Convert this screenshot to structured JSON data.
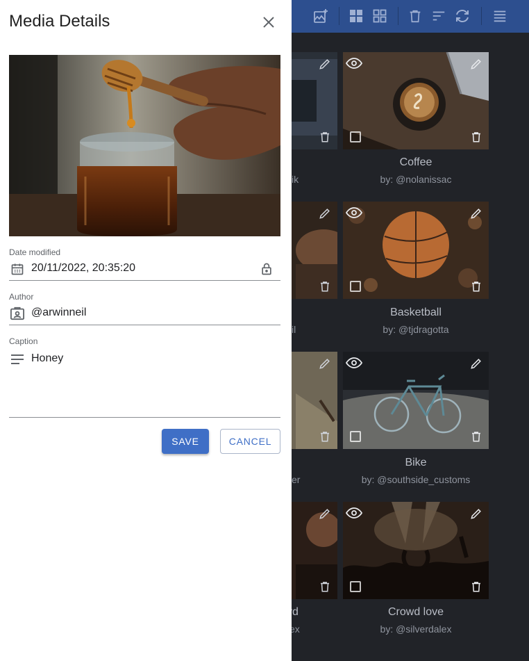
{
  "panel": {
    "title": "Media Details",
    "fields": {
      "date": {
        "label": "Date modified",
        "value": "20/11/2022, 20:35:20"
      },
      "author": {
        "label": "Author",
        "value": "@arwinneil"
      },
      "caption": {
        "label": "Caption",
        "value": "Honey"
      }
    },
    "buttons": {
      "save": "SAVE",
      "cancel": "CANCEL"
    }
  },
  "toolbar": {
    "icons": [
      "add-photo-icon",
      "grid-large-icon",
      "grid-small-icon",
      "delete-icon",
      "sort-icon",
      "refresh-icon",
      "list-view-icon"
    ]
  },
  "gallery": {
    "left_column_partial": [
      {
        "title": "",
        "author": "ik"
      },
      {
        "title": "",
        "author": "il"
      },
      {
        "title": "",
        "author": "er"
      },
      {
        "title": "vd",
        "author": "ex"
      }
    ],
    "right_column": [
      {
        "title": "Coffee",
        "author": "by: @nolanissac"
      },
      {
        "title": "Basketball",
        "author": "by: @tjdragotta"
      },
      {
        "title": "Bike",
        "author": "by: @southside_customs"
      },
      {
        "title": "Crowd love",
        "author": "by: @silverdalex"
      }
    ]
  },
  "colors": {
    "toolbar": "#2d4f8f",
    "accent": "#3f6fc6",
    "gallery_bg": "#212328"
  }
}
